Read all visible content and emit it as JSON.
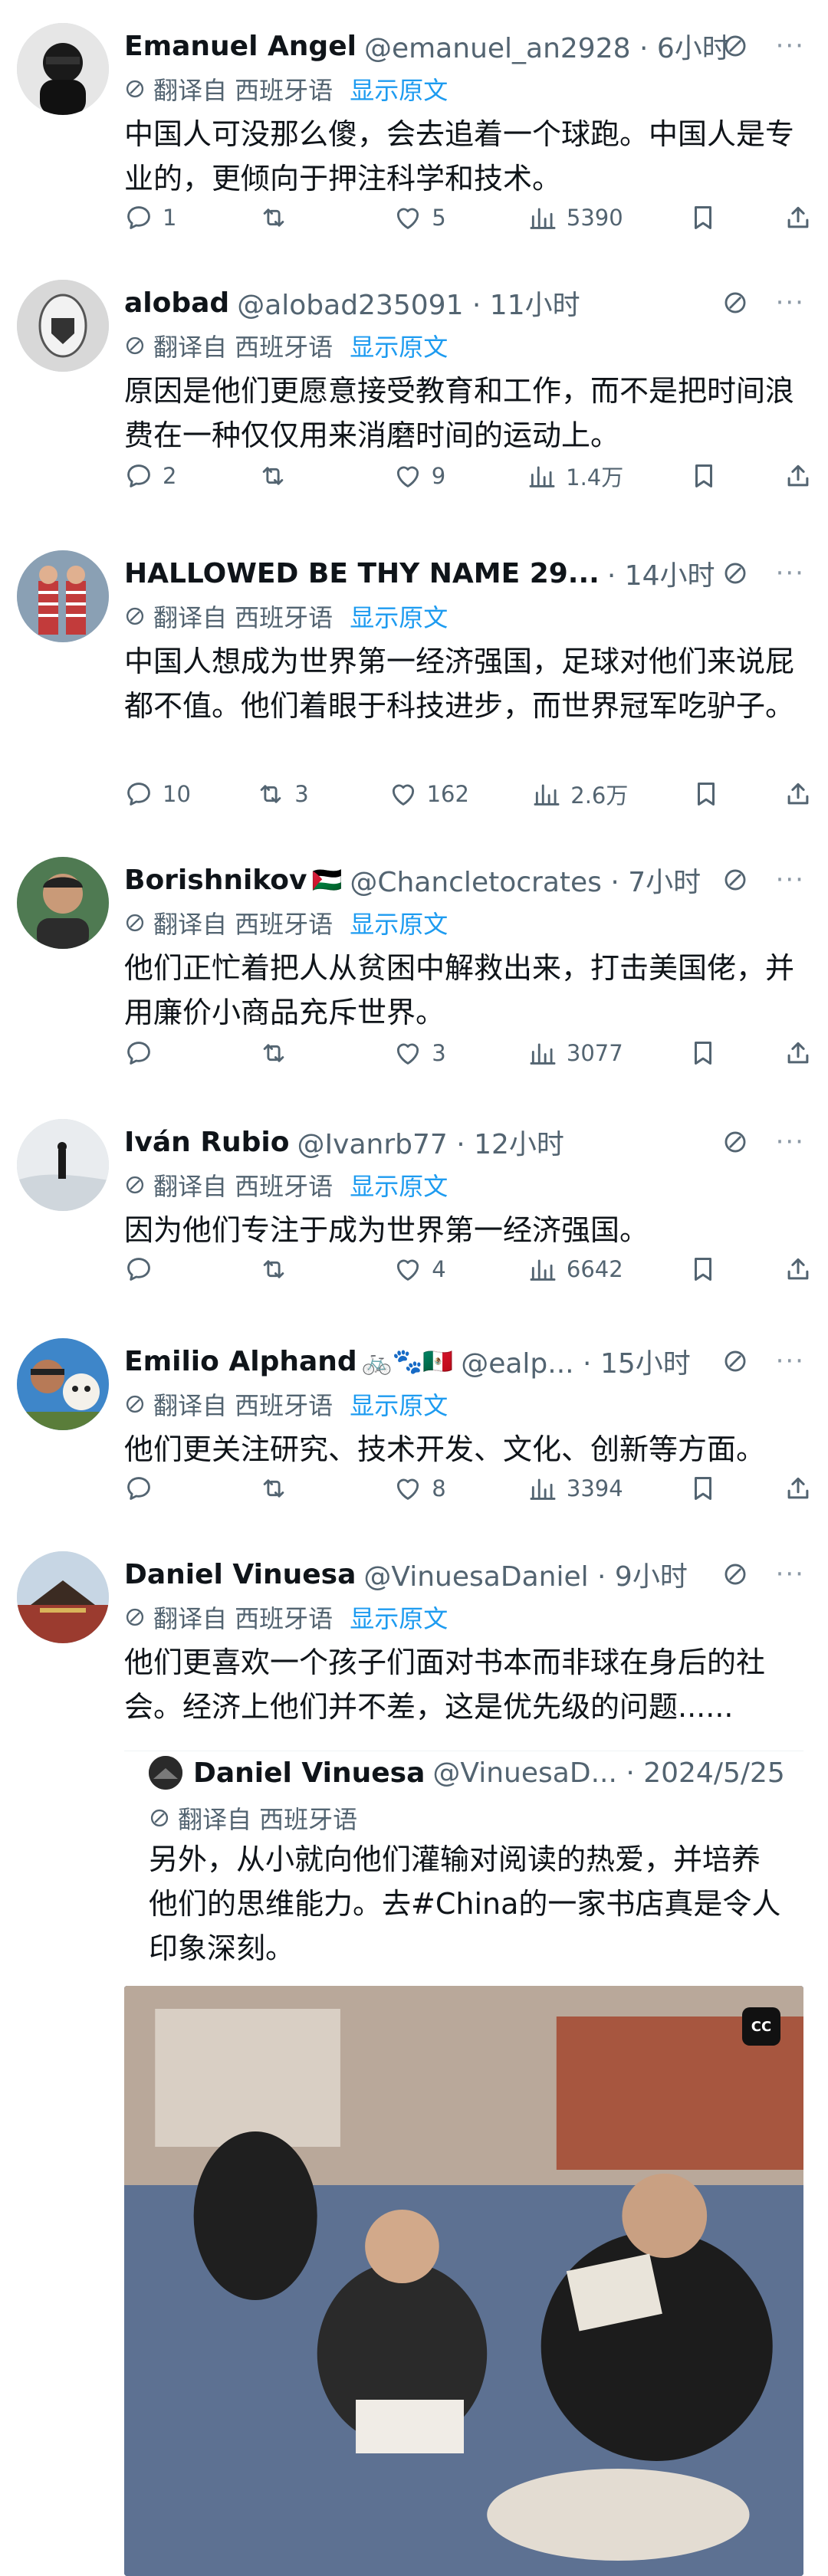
{
  "translate": {
    "prefix": "翻译自 西班牙语",
    "show_original": "显示原文"
  },
  "tweets": [
    {
      "name": "Emanuel Angel",
      "handle": "@emanuel_an2928 · 6小时",
      "flags": "",
      "text": "中国人可没那么傻，会去追着一个球跑。中国人是专业的，更倾向于押注科学和技术。",
      "replies": "1",
      "retweets": "",
      "likes": "5",
      "views": "5390"
    },
    {
      "name": "alobad",
      "handle": "@alobad235091 · 11小时",
      "flags": "",
      "text": "原因是他们更愿意接受教育和工作，而不是把时间浪费在一种仅仅用来消磨时间的运动上。",
      "replies": "2",
      "retweets": "",
      "likes": "9",
      "views": "1.4万"
    },
    {
      "name": "HALLOWED BE THY NAME 29...",
      "handle": "· 14小时",
      "flags": "",
      "text": "中国人想成为世界第一经济强国，足球对他们来说屁都不值。他们着眼于科技进步，而世界冠军吃驴子。",
      "replies": "10",
      "retweets": "3",
      "likes": "162",
      "views": "2.6万"
    },
    {
      "name": "Borishnikov",
      "handle": "@Chancletocrates · 7小时",
      "flags": "🇵🇸",
      "text": "他们正忙着把人从贫困中解救出来，打击美国佬，并用廉价小商品充斥世界。",
      "replies": "",
      "retweets": "",
      "likes": "3",
      "views": "3077"
    },
    {
      "name": "Iván Rubio",
      "handle": "@Ivanrb77 · 12小时",
      "flags": "",
      "text": "因为他们专注于成为世界第一经济强国。",
      "replies": "",
      "retweets": "",
      "likes": "4",
      "views": "6642"
    },
    {
      "name": "Emilio Alphand",
      "handle": "@ealp... · 15小时",
      "flags": "🚲🐾🇲🇽",
      "text": "他们更关注研究、技术开发、文化、创新等方面。",
      "replies": "",
      "retweets": "",
      "likes": "8",
      "views": "3394"
    },
    {
      "name": "Daniel Vinuesa",
      "handle": "@VinuesaDaniel · 9小时",
      "flags": "",
      "text": "他们更喜欢一个孩子们面对书本而非球在身后的社会。经济上他们并不差，这是优先级的问题......"
    }
  ],
  "quote": {
    "name": "Daniel Vinuesa",
    "handle": "@VinuesaD... · 2024/5/25",
    "text": "另外，从小就向他们灌输对阅读的热爱，并培养他们的思维能力。去#China的一家书店真是令人印象深刻。",
    "cc_label": "CC"
  }
}
